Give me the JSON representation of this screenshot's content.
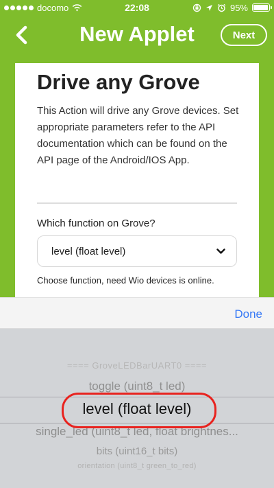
{
  "status": {
    "carrier": "docomo",
    "time": "22:08",
    "battery": "95%",
    "battery_level": 0.95
  },
  "nav": {
    "title": "New Applet",
    "next_label": "Next"
  },
  "card": {
    "title": "Drive any Grove",
    "description": "This Action will drive any Grove devices. Set appropriate parameters refer to the API documentation which can be found on the API page of the Android/IOS App.",
    "field_label": "Which function on Grove?",
    "select_value": "level (float level)",
    "helper_text": "Choose function, need Wio devices is online."
  },
  "accessory": {
    "done_label": "Done"
  },
  "picker": {
    "rows": [
      "==== GroveLEDBarUART0 ====",
      "toggle (uint8_t led)",
      "level (float level)",
      "single_led (uint8_t led, float brightnes...",
      "bits (uint16_t bits)",
      "orientation (uint8_t green_to_red)"
    ],
    "selected_index": 2
  },
  "colors": {
    "brand_green": "#7fbd2c",
    "accent_blue": "#3478f6",
    "highlight_red": "#e8231f"
  }
}
